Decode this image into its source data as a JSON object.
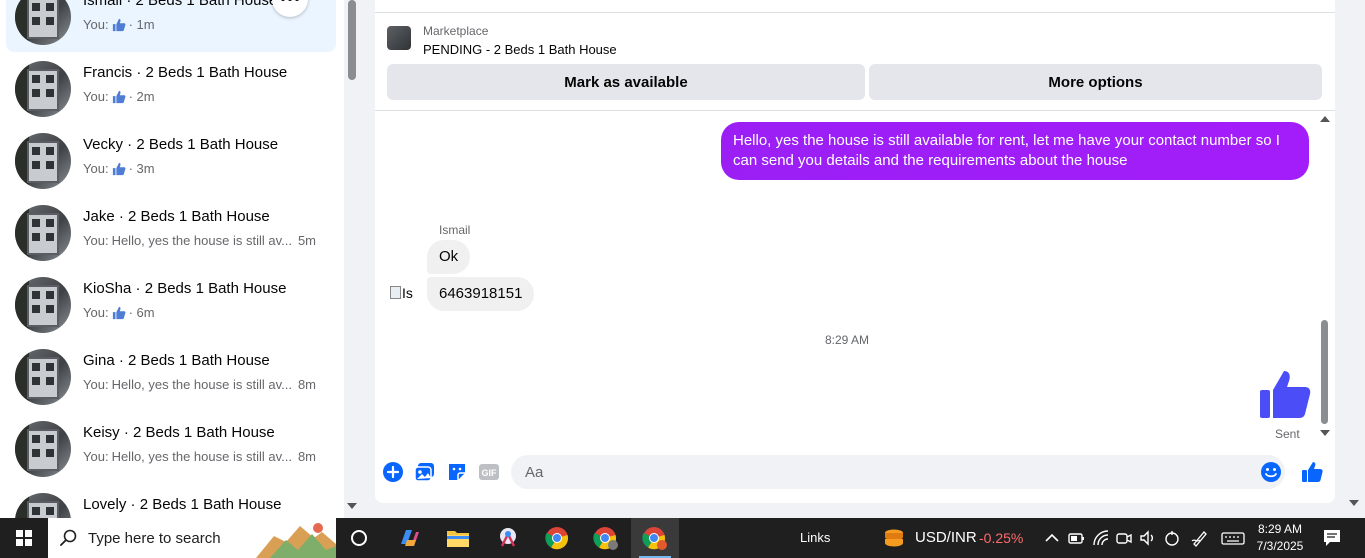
{
  "conversations": [
    {
      "name": "Ismail · 2 Beds 1 Bath House",
      "prefix": "You:",
      "message": "",
      "liked": true,
      "time": "· 1m",
      "active": true
    },
    {
      "name": "Francis · 2 Beds 1 Bath House",
      "prefix": "You:",
      "message": "",
      "liked": true,
      "time": "· 2m"
    },
    {
      "name": "Vecky · 2 Beds 1 Bath House",
      "prefix": "You:",
      "message": "",
      "liked": true,
      "time": "· 3m"
    },
    {
      "name": "Jake · 2 Beds 1 Bath House",
      "prefix": "You:",
      "message": "Hello, yes the house is still av...",
      "liked": false,
      "time": "5m"
    },
    {
      "name": "KioSha · 2 Beds 1 Bath House",
      "prefix": "You:",
      "message": "",
      "liked": true,
      "time": "· 6m"
    },
    {
      "name": "Gina · 2 Beds 1 Bath House",
      "prefix": "You:",
      "message": "Hello, yes the house is still av...",
      "liked": false,
      "time": "8m"
    },
    {
      "name": "Keisy · 2 Beds 1 Bath House",
      "prefix": "You:",
      "message": "Hello, yes the house is still av...",
      "liked": false,
      "time": "8m"
    },
    {
      "name": "Lovely · 2 Beds 1 Bath House",
      "prefix": "",
      "message": "",
      "liked": false,
      "time": ""
    }
  ],
  "chat": {
    "marketplace_label": "Marketplace",
    "listing_title": "PENDING - 2 Beds 1 Bath House",
    "mark_available_label": "Mark as available",
    "more_options_label": "More options",
    "outgoing_message": "Hello, yes the house is still available for rent, let me have your contact number so I can send you details and the requirements about the house",
    "sender_name": "Ismail",
    "incoming_messages": [
      "Ok",
      "6463918151"
    ],
    "broken_avatar_alt": "Is",
    "timestamp": "8:29 AM",
    "sent_status": "Sent",
    "composer_placeholder": "Aa",
    "accent_color": "#0866ff",
    "outgoing_bubble_color": "#a31dfa",
    "like_icon_color": "#4b4ef7"
  },
  "taskbar": {
    "search_placeholder": "Type here to search",
    "links_label": "Links",
    "fx_label": "USD/INR",
    "fx_change": "-0.25%",
    "time": "8:29 AM",
    "date": "7/3/2025"
  }
}
